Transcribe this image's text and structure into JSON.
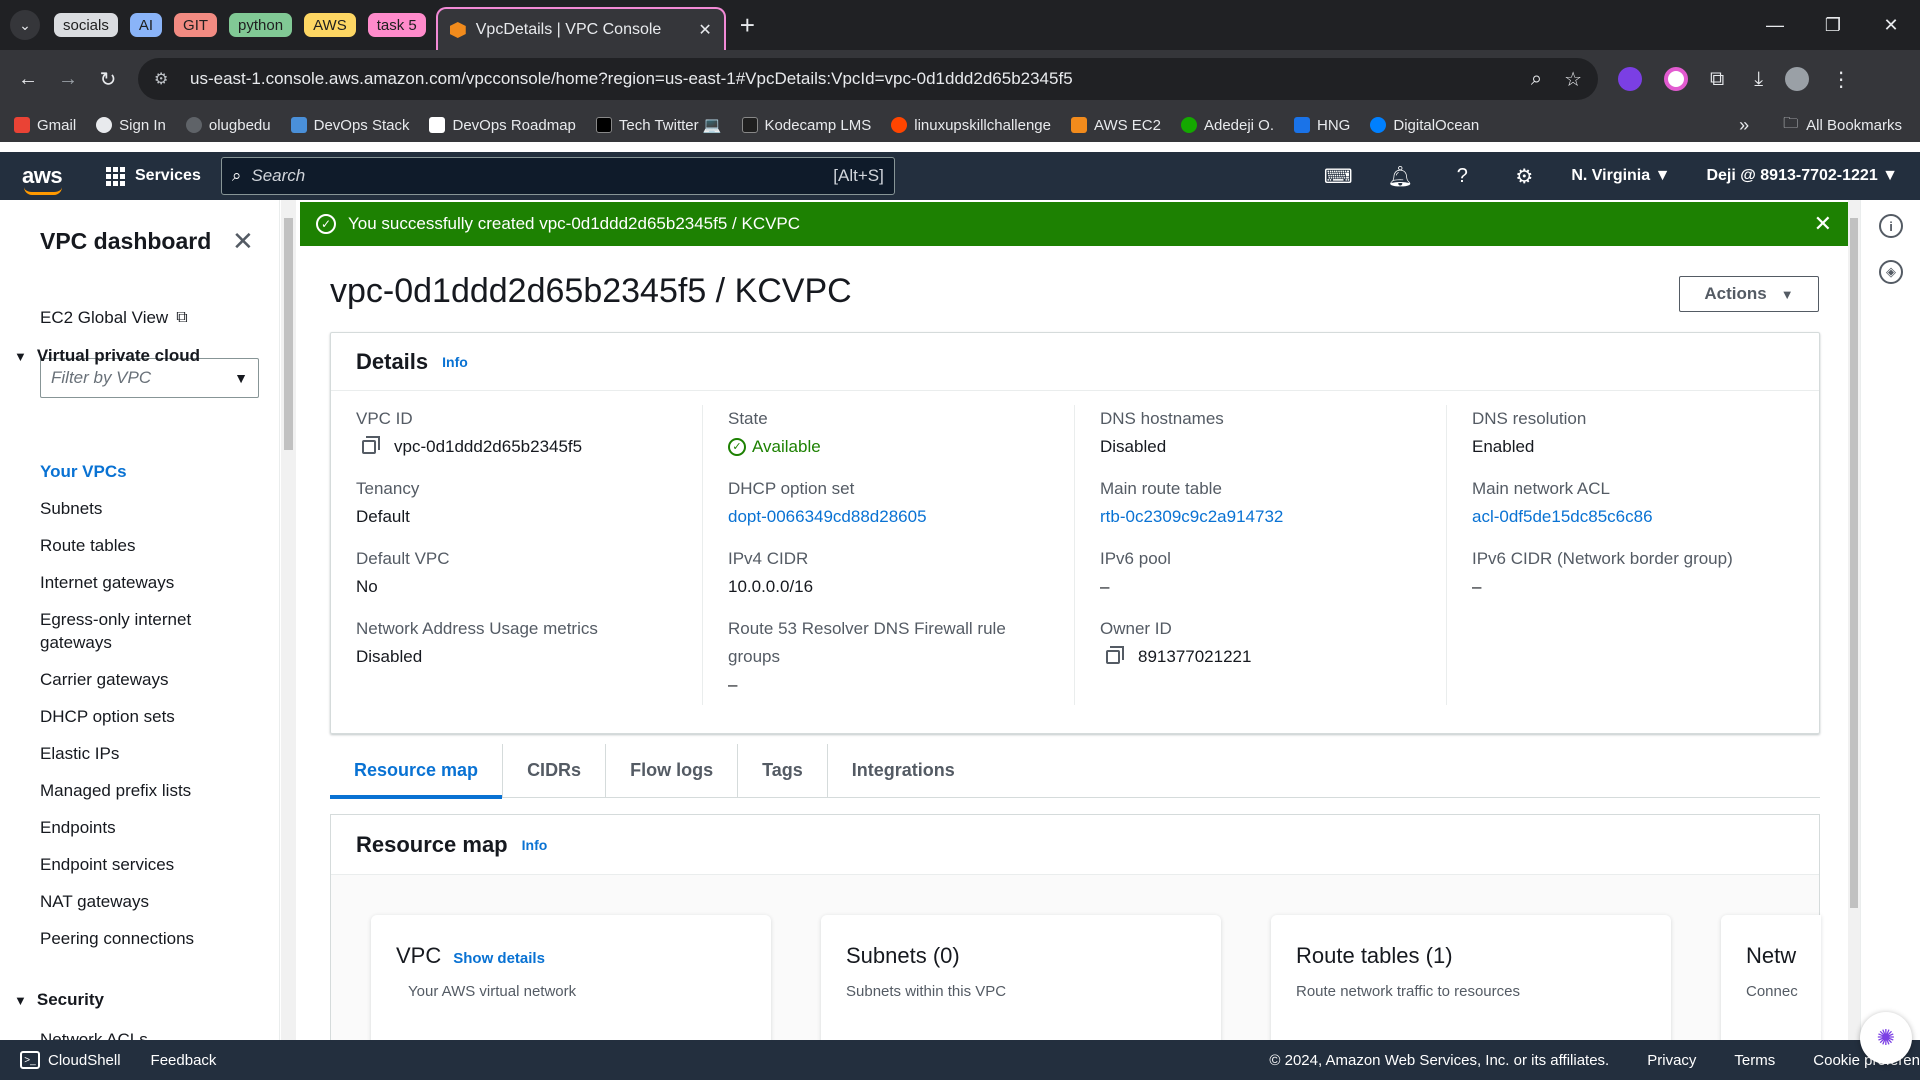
{
  "browser": {
    "tab_groups": [
      {
        "label": "socials",
        "color": "#dadce0"
      },
      {
        "label": "AI",
        "color": "#8ab4f8"
      },
      {
        "label": "GIT",
        "color": "#f28b82"
      },
      {
        "label": "python",
        "color": "#81c995"
      },
      {
        "label": "AWS",
        "color": "#fdd663"
      },
      {
        "label": "task 5",
        "color": "#ff8bcb"
      }
    ],
    "active_tab_title": "VpcDetails | VPC Console",
    "url": "us-east-1.console.aws.amazon.com/vpcconsole/home?region=us-east-1#VpcDetails:VpcId=vpc-0d1ddd2d65b2345f5",
    "bookmarks": [
      {
        "label": "Gmail",
        "color": "#ea4335"
      },
      {
        "label": "Sign In",
        "color": "#e8eaed"
      },
      {
        "label": "olugbedu",
        "color": "#5f6368"
      },
      {
        "label": "DevOps Stack",
        "color": "#4a90d9"
      },
      {
        "label": "DevOps Roadmap",
        "color": "#ffffff"
      },
      {
        "label": "Tech Twitter 💻",
        "color": "#000000"
      },
      {
        "label": "Kodecamp LMS",
        "color": "#1f1f1f"
      },
      {
        "label": "linuxupskillchallenge",
        "color": "#ff4500"
      },
      {
        "label": "AWS EC2",
        "color": "#f28b1c"
      },
      {
        "label": "Adedeji O.",
        "color": "#14a800"
      },
      {
        "label": "HNG",
        "color": "#1a73e8"
      },
      {
        "label": "DigitalOcean",
        "color": "#0080ff"
      }
    ],
    "all_bookmarks": "All Bookmarks"
  },
  "aws_nav": {
    "logo": "aws",
    "services": "Services",
    "search_placeholder": "Search",
    "search_shortcut": "[Alt+S]",
    "region": "N. Virginia ▼",
    "account": "Deji @ 8913-7702-1221 ▼"
  },
  "sidebar": {
    "title": "VPC dashboard",
    "global_view": "EC2 Global View",
    "filter_placeholder": "Filter by VPC",
    "section_vpc": "Virtual private cloud",
    "items": [
      "Your VPCs",
      "Subnets",
      "Route tables",
      "Internet gateways",
      "Egress-only internet gateways",
      "Carrier gateways",
      "DHCP option sets",
      "Elastic IPs",
      "Managed prefix lists",
      "Endpoints",
      "Endpoint services",
      "NAT gateways",
      "Peering connections"
    ],
    "section_security": "Security",
    "partial_item": "Network ACLs"
  },
  "flash": {
    "message": "You successfully created vpc-0d1ddd2d65b2345f5 / KCVPC"
  },
  "page": {
    "title": "vpc-0d1ddd2d65b2345f5 / KCVPC",
    "actions": "Actions"
  },
  "details": {
    "heading": "Details",
    "info": "Info",
    "vpc_id_label": "VPC ID",
    "vpc_id": "vpc-0d1ddd2d65b2345f5",
    "tenancy_label": "Tenancy",
    "tenancy": "Default",
    "default_vpc_label": "Default VPC",
    "default_vpc": "No",
    "nau_label": "Network Address Usage metrics",
    "nau": "Disabled",
    "state_label": "State",
    "state": "Available",
    "dhcp_label": "DHCP option set",
    "dhcp": "dopt-0066349cd88d28605",
    "ipv4_label": "IPv4 CIDR",
    "ipv4": "10.0.0.0/16",
    "r53_label": "Route 53 Resolver DNS Firewall rule groups",
    "r53": "–",
    "dns_host_label": "DNS hostnames",
    "dns_host": "Disabled",
    "main_rt_label": "Main route table",
    "main_rt": "rtb-0c2309c9c2a914732",
    "ipv6_pool_label": "IPv6 pool",
    "ipv6_pool": "–",
    "owner_label": "Owner ID",
    "owner": "891377021221",
    "dns_res_label": "DNS resolution",
    "dns_res": "Enabled",
    "main_acl_label": "Main network ACL",
    "main_acl": "acl-0df5de15dc85c6c86",
    "ipv6_cidr_label": "IPv6 CIDR (Network border group)",
    "ipv6_cidr": "–"
  },
  "tabs": [
    "Resource map",
    "CIDRs",
    "Flow logs",
    "Tags",
    "Integrations"
  ],
  "resource_map": {
    "heading": "Resource map",
    "info": "Info",
    "vpc_title": "VPC",
    "vpc_show": "Show details",
    "vpc_sub": "Your AWS virtual network",
    "subnets_title": "Subnets (0)",
    "subnets_sub": "Subnets within this VPC",
    "rt_title": "Route tables (1)",
    "rt_sub": "Route network traffic to resources",
    "net_title": "Netw",
    "net_sub": "Connec"
  },
  "footer": {
    "cloudshell": "CloudShell",
    "feedback": "Feedback",
    "copyright": "© 2024, Amazon Web Services, Inc. or its affiliates.",
    "privacy": "Privacy",
    "terms": "Terms",
    "cookies": "Cookie preferen"
  }
}
